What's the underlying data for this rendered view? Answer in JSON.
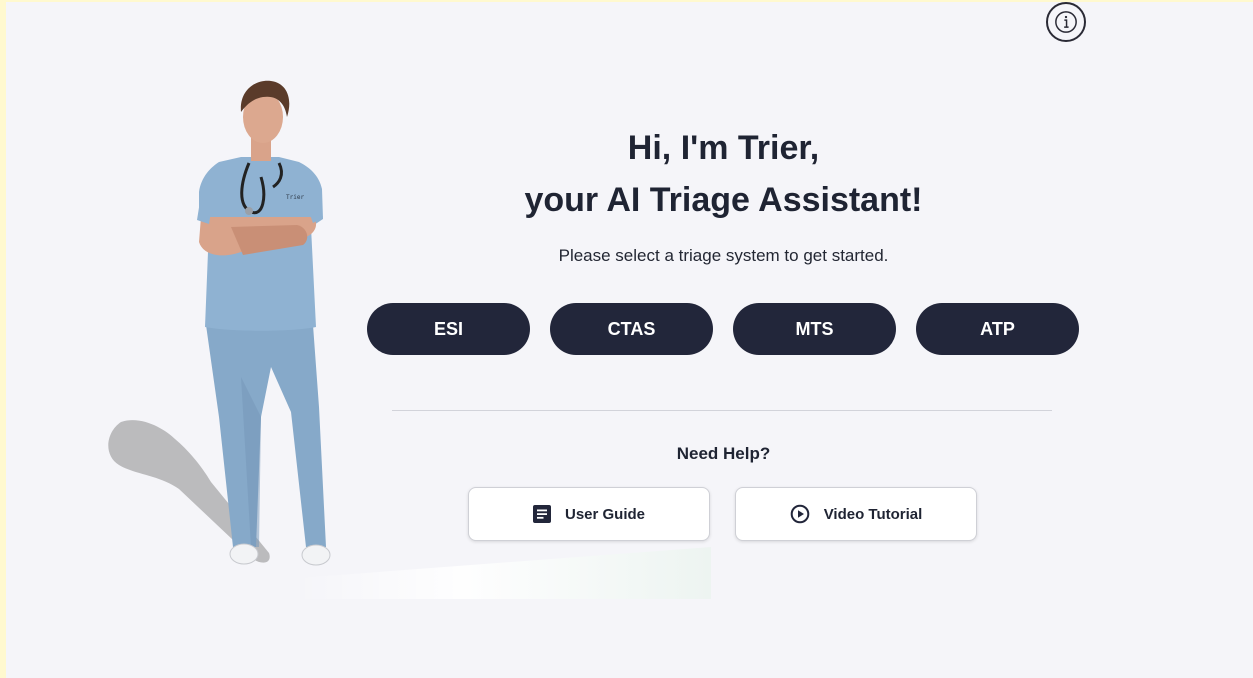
{
  "header": {
    "info_icon": "info-circle-icon"
  },
  "hero": {
    "heading_line1": "Hi, I'm Trier,",
    "heading_line2": "your AI Triage Assistant!",
    "subtitle": "Please select a triage system to get started.",
    "avatar_badge": "Trier"
  },
  "triage_systems": [
    {
      "label": "ESI"
    },
    {
      "label": "CTAS"
    },
    {
      "label": "MTS"
    },
    {
      "label": "ATP"
    }
  ],
  "help": {
    "title": "Need Help?",
    "user_guide": {
      "label": "User Guide",
      "icon": "document-icon"
    },
    "video_tutorial": {
      "label": "Video Tutorial",
      "icon": "play-circle-icon"
    }
  },
  "colors": {
    "background": "#f5f5f9",
    "primary_button": "#22263a",
    "primary_button_text": "#ffffff",
    "scrubs": "#8fb2d2",
    "window_border": "#fff9cf"
  }
}
